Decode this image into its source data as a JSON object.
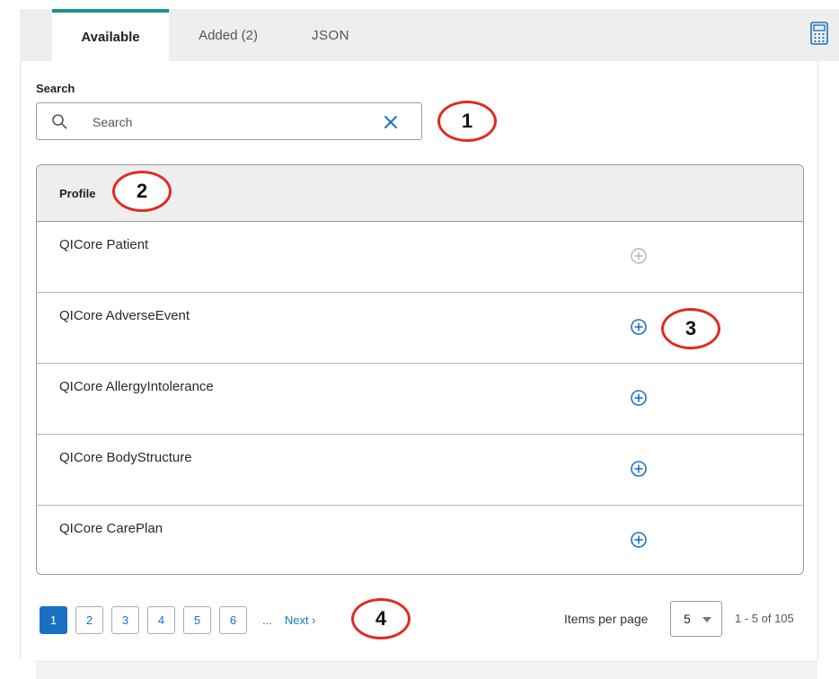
{
  "tabs": [
    {
      "label": "Available",
      "active": true
    },
    {
      "label": "Added (2)",
      "active": false
    },
    {
      "label": "JSON",
      "active": false
    }
  ],
  "toolbar": {
    "calculator_icon": "calculator-icon"
  },
  "search": {
    "label": "Search",
    "value": "",
    "placeholder": "Search",
    "search_icon": "search-icon",
    "clear_icon": "close-icon"
  },
  "table": {
    "header": "Profile",
    "rows": [
      {
        "name": "QICore Patient",
        "action": "add",
        "enabled": false
      },
      {
        "name": "QICore AdverseEvent",
        "action": "add",
        "enabled": true
      },
      {
        "name": "QICore AllergyIntolerance",
        "action": "add",
        "enabled": true
      },
      {
        "name": "QICore BodyStructure",
        "action": "add",
        "enabled": true
      },
      {
        "name": "QICore CarePlan",
        "action": "add",
        "enabled": true
      }
    ]
  },
  "pagination": {
    "pages": [
      "1",
      "2",
      "3",
      "4",
      "5",
      "6"
    ],
    "current_page": "1",
    "ellipsis": "...",
    "next_label": "Next ›",
    "items_per_page_label": "Items per page",
    "items_per_page_value": "5",
    "range_text": "1 - 5 of 105"
  },
  "callouts": [
    "1",
    "2",
    "3",
    "4"
  ],
  "colors": {
    "accent": "#1e8f96",
    "link": "#1a73c6",
    "active_page": "#1a6fc4",
    "disabled_icon": "#b5b5b5",
    "callout_ring": "#e02b20"
  }
}
